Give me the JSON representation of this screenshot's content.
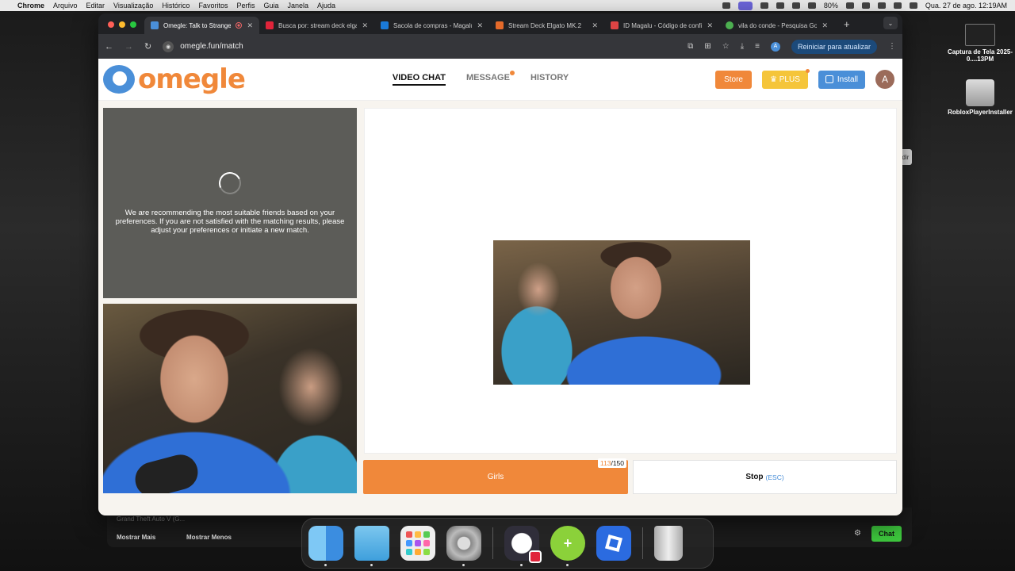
{
  "menubar": {
    "app": "Chrome",
    "items": [
      "Arquivo",
      "Editar",
      "Visualização",
      "Histórico",
      "Favoritos",
      "Perfis",
      "Guia",
      "Janela",
      "Ajuda"
    ],
    "battery": "80%",
    "clock": "Qua. 27 de ago.  12:19AM"
  },
  "desktop": {
    "icons": [
      {
        "label": "Captura de Tela 2025-0....13PM",
        "icon": "screenshot-file"
      },
      {
        "label": "RobloxPlayerInstaller",
        "icon": "disk-image"
      }
    ],
    "background_window": {
      "game_row": "Grand Theft Auto V (G...",
      "show_more": "Mostrar Mais",
      "show_less": "Mostrar Menos",
      "chat_button": "Chat",
      "side_tab": "dir"
    }
  },
  "browser": {
    "tabs": [
      {
        "title": "Omegle: Talk to Strangers",
        "active": true,
        "favicon_color": "#4a8fd8"
      },
      {
        "title": "Busca por: stream deck elgato",
        "active": false,
        "favicon_color": "#e0243a"
      },
      {
        "title": "Sacola de compras - Magalu",
        "active": false,
        "favicon_color": "#1a7ad8"
      },
      {
        "title": "Stream Deck Elgato MK.2",
        "active": false,
        "favicon_color": "#e56a2a"
      },
      {
        "title": "ID Magalu - Código de confirmação",
        "active": false,
        "favicon_color": "#d44"
      },
      {
        "title": "vila do conde - Pesquisa Google",
        "active": false,
        "favicon_color": "#4caf50"
      }
    ],
    "new_tab": "+",
    "url": "omegle.fun/match",
    "profile_initial": "A",
    "update_button": "Reiniciar para atualizar"
  },
  "site": {
    "logo_text": "omegle",
    "nav": {
      "video_chat": "VIDEO CHAT",
      "message": "MESSAGE",
      "history": "HISTORY"
    },
    "buttons": {
      "store": "Store",
      "plus": "PLUS",
      "install": "Install"
    },
    "user_initial": "A",
    "waiting_message": "We are recommending the most suitable friends based on your preferences. If you are not satisfied with the matching results, please adjust your preferences or initiate a new match.",
    "match_button": "Girls",
    "counter_used": "113",
    "counter_total": "/150",
    "stop_button": "Stop",
    "stop_shortcut": "(ESC)"
  }
}
